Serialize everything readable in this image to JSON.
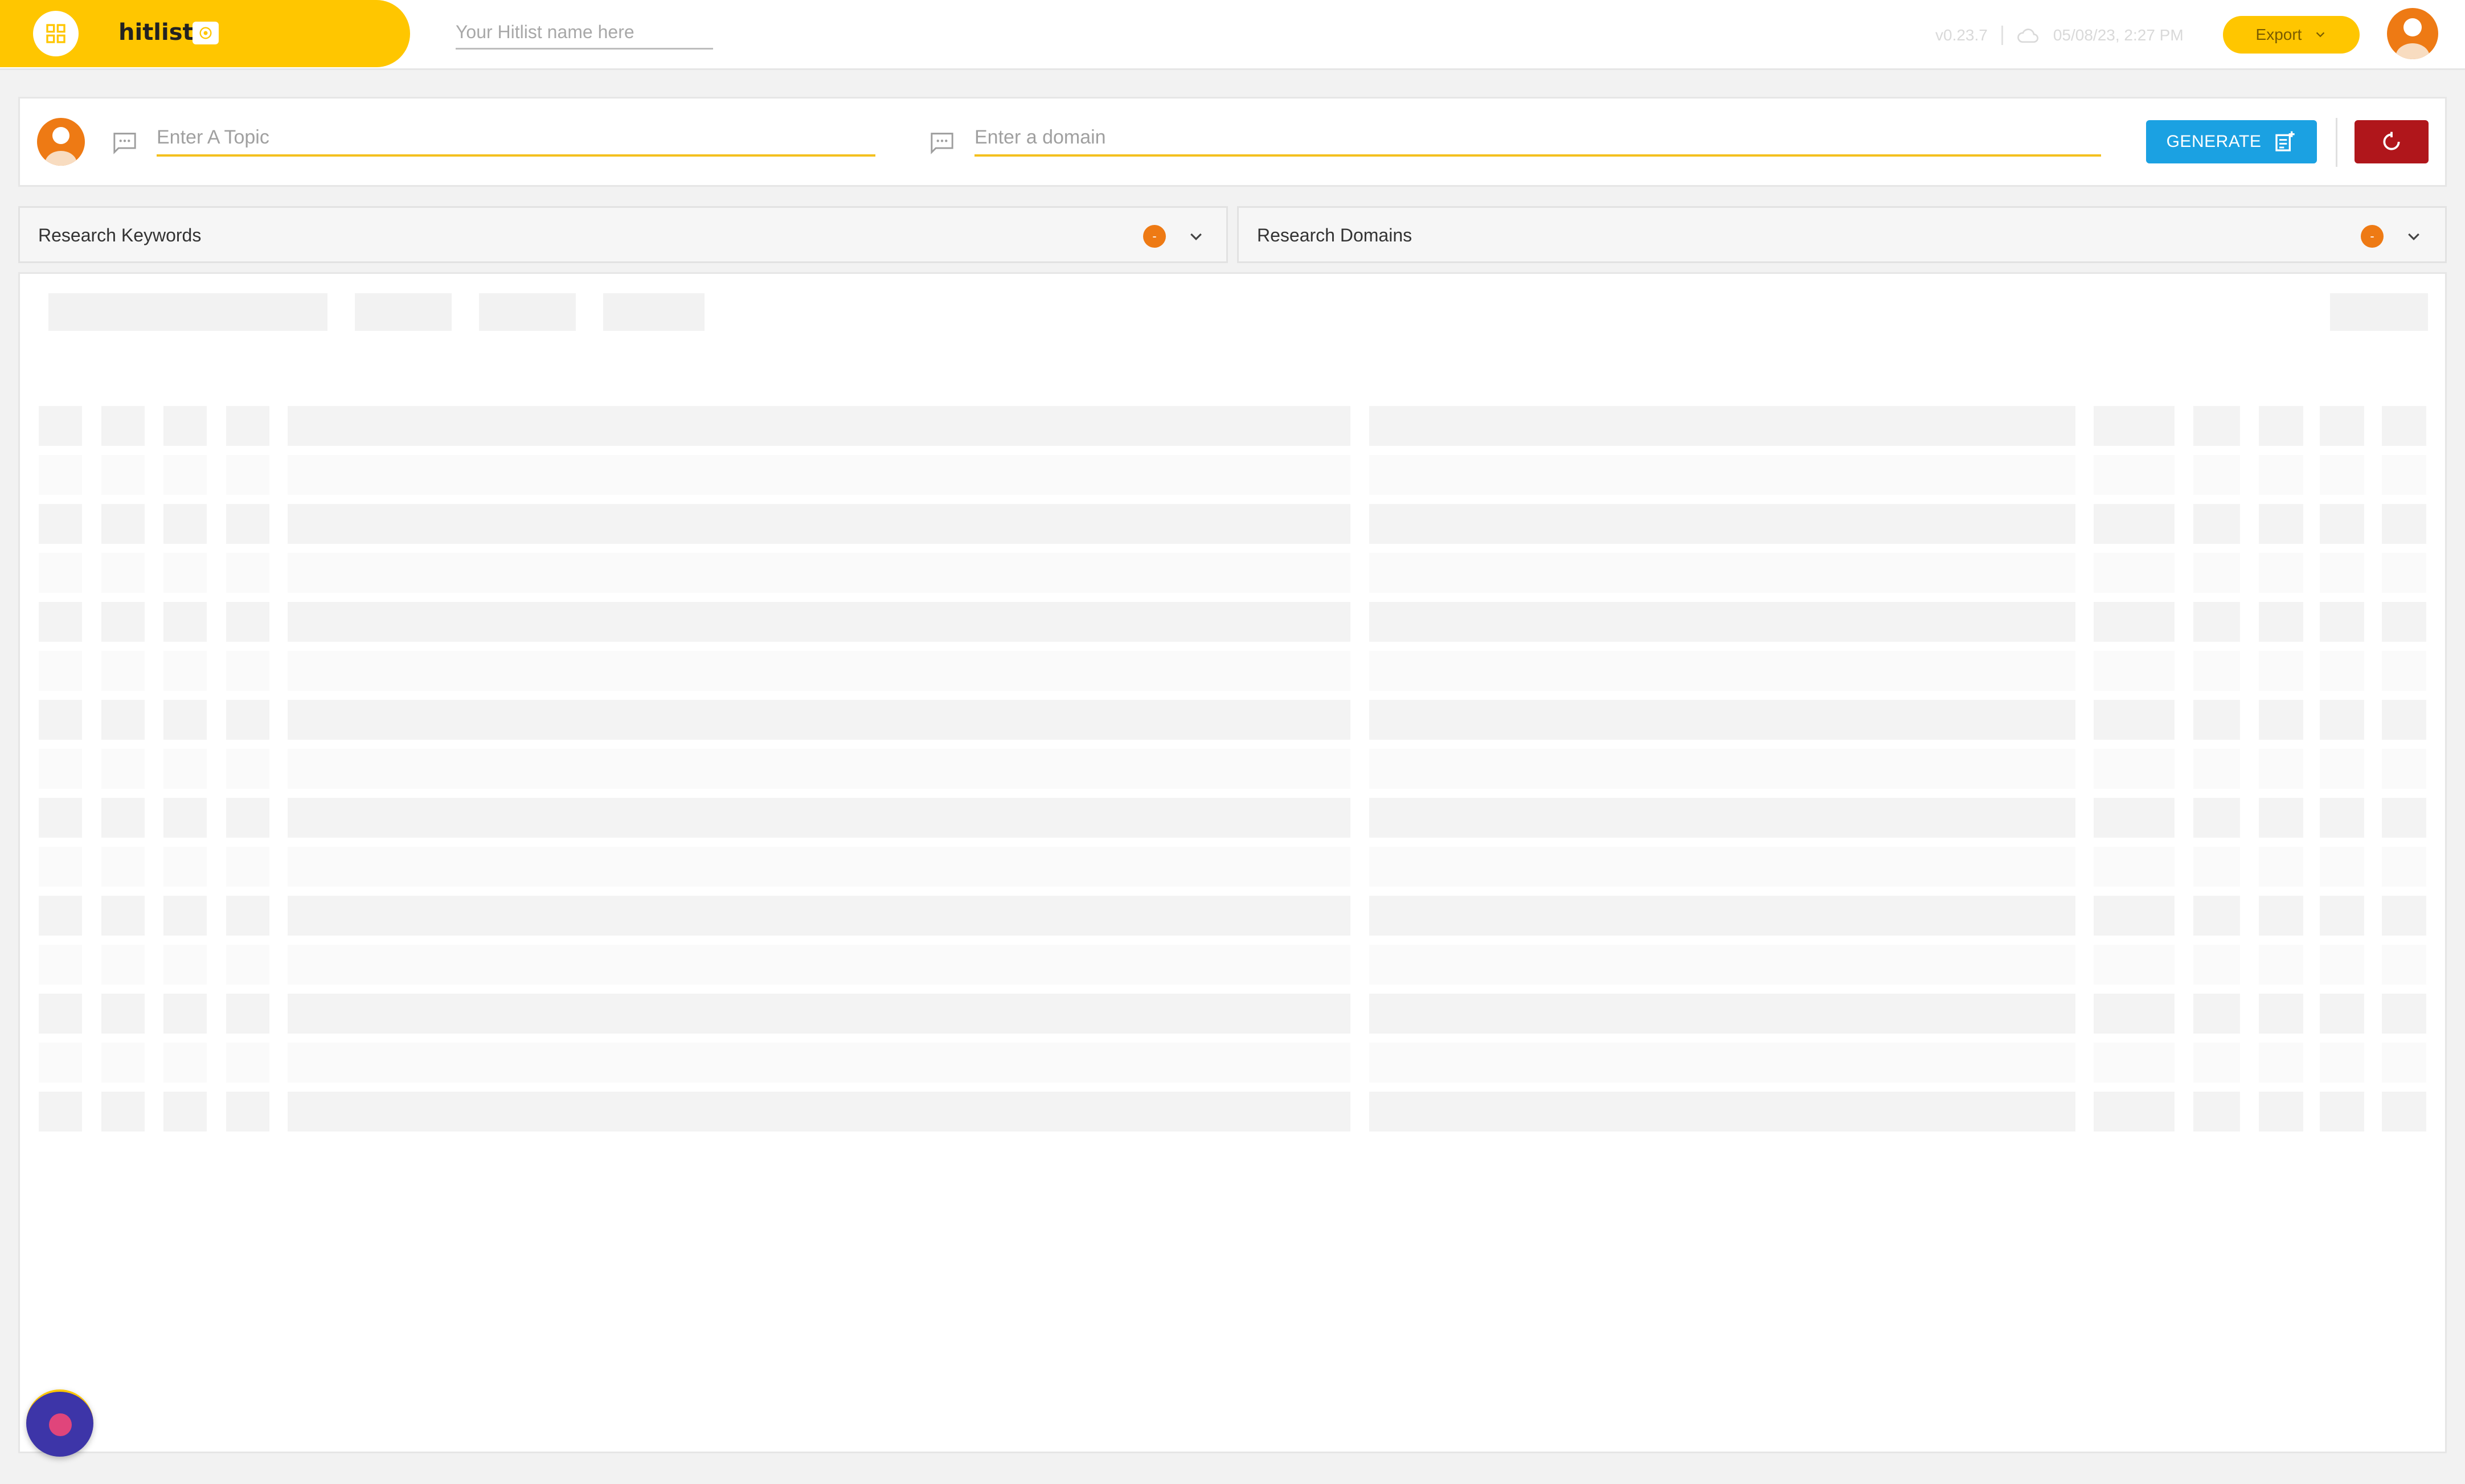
{
  "app": {
    "name": "hitlist",
    "hitlist_name_placeholder": "Your Hitlist name here",
    "version": "v0.23.7",
    "timestamp": "05/08/23, 2:27 PM",
    "export_label": "Export"
  },
  "search": {
    "topic_placeholder": "Enter A Topic",
    "domain_placeholder": "Enter a domain",
    "generate_label": "GENERATE"
  },
  "research": {
    "keywords": {
      "label": "Research Keywords",
      "badge": "-"
    },
    "domains": {
      "label": "Research Domains",
      "badge": "-"
    }
  },
  "colors": {
    "brand": "#ffc600",
    "generate": "#1ba1e2",
    "reset": "#b0161b",
    "avatar": "#ee7a14"
  },
  "icons": {
    "apps": "grid-icon",
    "brand_badge": "star-badge-icon",
    "cloud": "cloud-icon",
    "export_chevron": "chevron-down-icon",
    "chat": "chat-bubble-icon",
    "generate": "note-add-icon",
    "reset": "refresh-icon"
  },
  "table": {
    "state": "loading",
    "skeleton_rows": 15
  }
}
